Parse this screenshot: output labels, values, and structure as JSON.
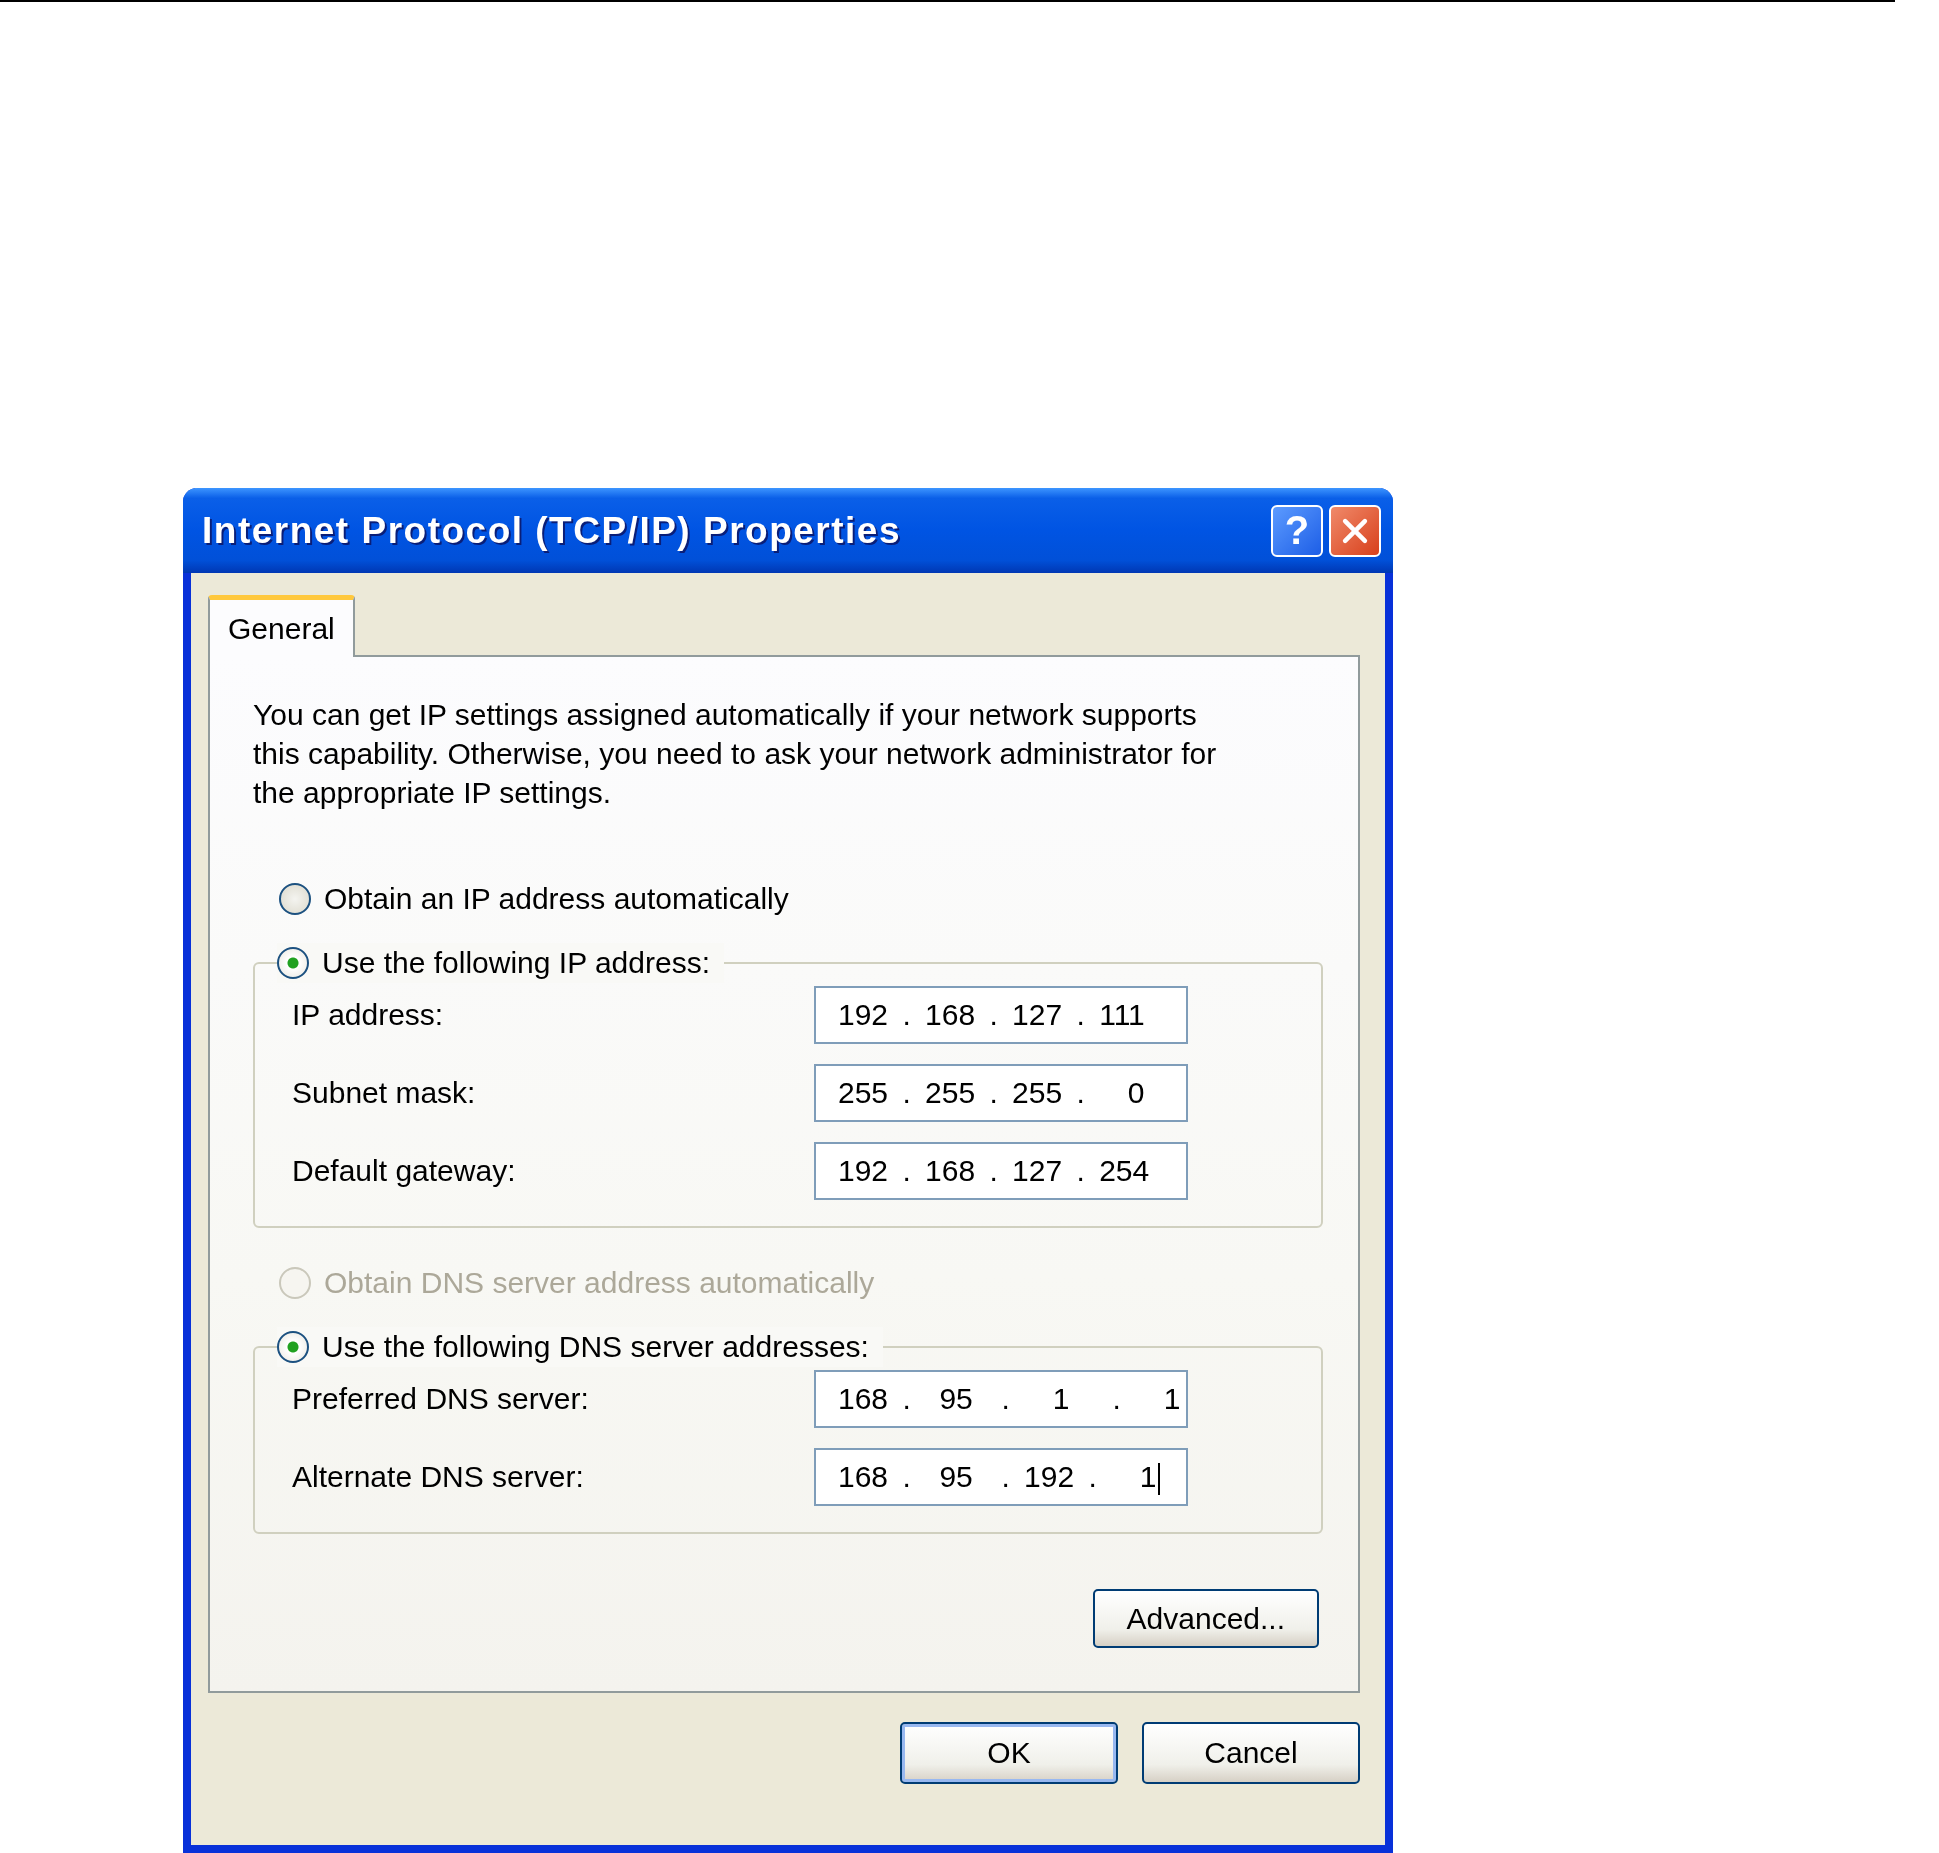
{
  "window": {
    "title": "Internet Protocol (TCP/IP) Properties"
  },
  "title_buttons": [
    {
      "kind": "help",
      "label": "?"
    },
    {
      "kind": "close"
    }
  ],
  "tabs": [
    {
      "label": "General",
      "selected": true
    }
  ],
  "description": "You can get IP settings assigned automatically if your network supports this capability. Otherwise, you need to ask your network administrator for the appropriate IP settings.",
  "sections": [
    {
      "auto_option": {
        "label": "Obtain an IP address automatically",
        "selected": false,
        "disabled": false
      },
      "manual_option": {
        "label": "Use the following IP address:",
        "selected": true,
        "disabled": false
      },
      "fields": [
        {
          "label": "IP address:",
          "value": "192 . 168 . 127 . 111",
          "caret": false
        },
        {
          "label": "Subnet mask:",
          "value": "255 . 255 . 255 .   0",
          "caret": false
        },
        {
          "label": "Default gateway:",
          "value": "192 . 168 . 127 . 254",
          "caret": false
        }
      ]
    },
    {
      "auto_option": {
        "label": "Obtain DNS server address automatically",
        "selected": false,
        "disabled": true
      },
      "manual_option": {
        "label": "Use the following DNS server addresses:",
        "selected": true,
        "disabled": false
      },
      "fields": [
        {
          "label": "Preferred DNS server:",
          "value": "168 .  95  .   1   .   1",
          "caret": false
        },
        {
          "label": "Alternate DNS server:",
          "value": "168 .  95  . 192 .   1",
          "caret": true
        }
      ]
    }
  ],
  "advanced_button": "Advanced...",
  "buttons": [
    {
      "label": "OK",
      "default": true
    },
    {
      "label": "Cancel",
      "default": false
    }
  ]
}
